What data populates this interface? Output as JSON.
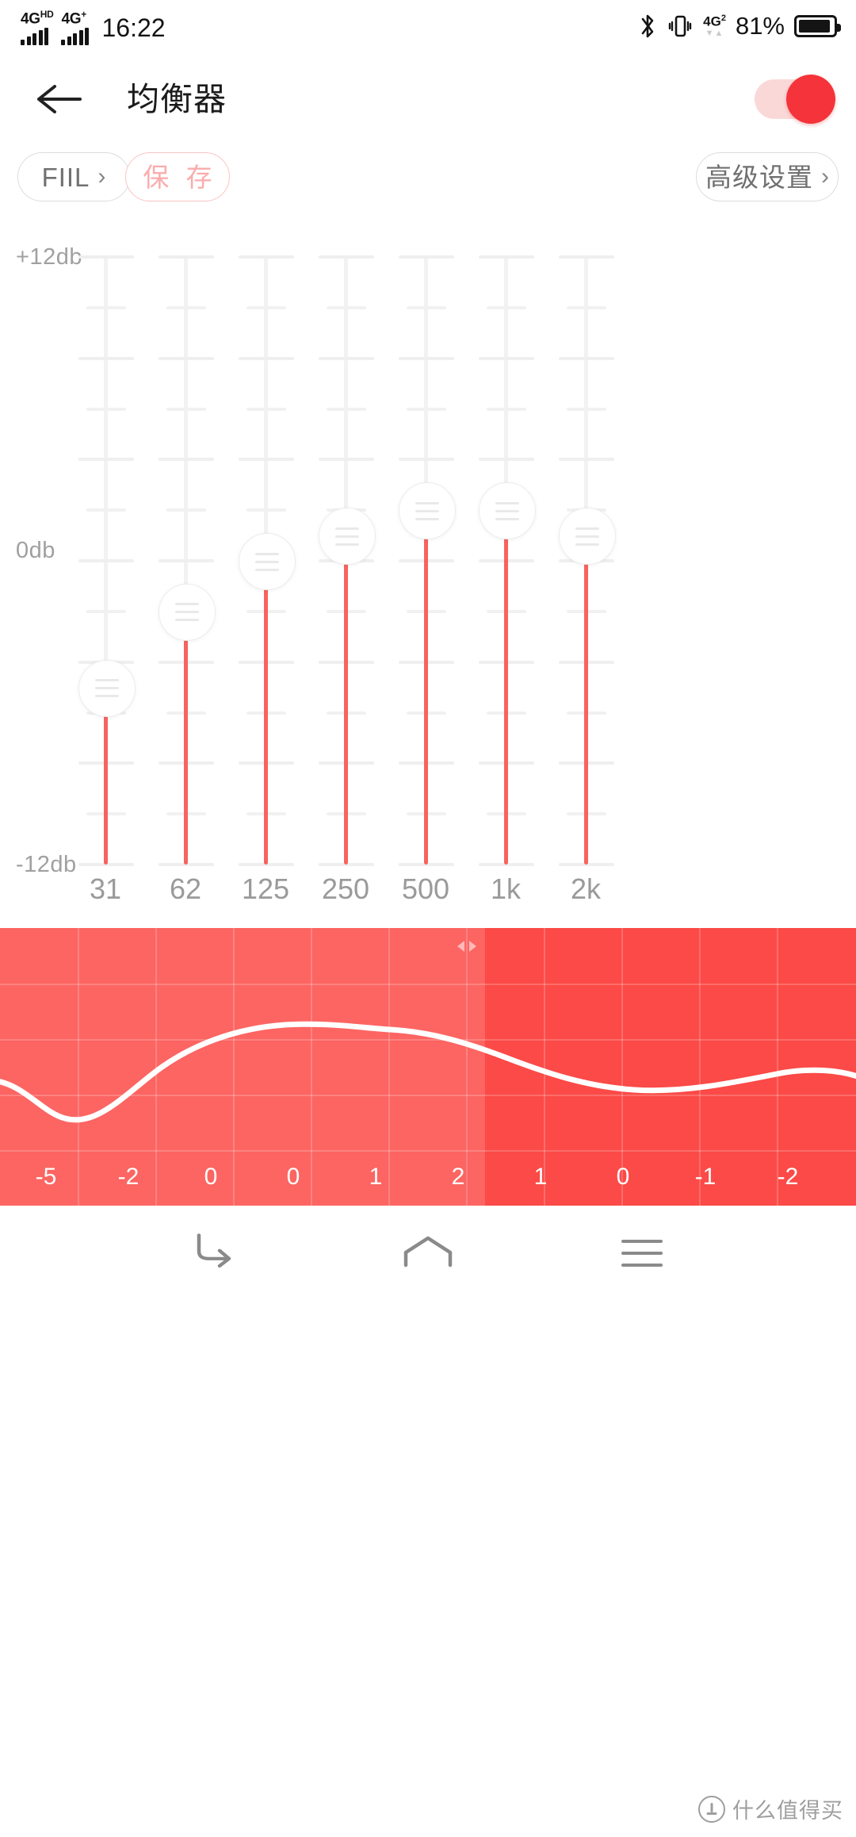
{
  "status_bar": {
    "network_primary": "4G",
    "network_primary_sup": "HD",
    "network_secondary": "4G",
    "network_secondary_sup": "+",
    "time": "16:22",
    "bluetooth_icon": "bluetooth-icon",
    "vibrate_icon": "vibrate-icon",
    "data_network": "4G",
    "data_network_sup": "2",
    "battery_percent": "81%",
    "battery_icon": "battery-icon"
  },
  "header": {
    "back_icon": "back-arrow-icon",
    "title": "均衡器",
    "toggle_state": "on"
  },
  "toolbar": {
    "preset_label": "FIIL",
    "preset_chevron": "›",
    "save_label": "保 存",
    "advanced_label": "高级设置",
    "advanced_chevron": "›"
  },
  "equalizer": {
    "axis_top": "+12db",
    "axis_mid": "0db",
    "axis_bottom": "-12db"
  },
  "chart_data": {
    "type": "bar",
    "title": "均衡器",
    "xlabel": "",
    "ylabel": "db",
    "ylim": [
      -12,
      12
    ],
    "grid": true,
    "categories": [
      "31",
      "62",
      "125",
      "250",
      "500",
      "1k",
      "2k"
    ],
    "values": [
      -5,
      -2,
      0,
      1,
      2,
      2,
      1
    ],
    "units": "db",
    "tick_labels_y": [
      "+12db",
      "0db",
      "-12db"
    ],
    "legend": []
  },
  "curve_panel": {
    "type": "line",
    "background_color": "#fc6562",
    "shade_color": "#fb4a47",
    "line_color": "#ffffff",
    "handle_icon": "drag-handle-icon",
    "values": [
      "-5",
      "-2",
      "0",
      "0",
      "1",
      "2",
      "1",
      "0",
      "-1",
      "-2"
    ]
  },
  "navbar": {
    "back_icon": "nav-back-icon",
    "home_icon": "nav-home-icon",
    "recent_icon": "nav-recent-icon"
  },
  "watermark": {
    "logo_icon": "smzdm-logo-icon",
    "text": "什么值得买"
  }
}
